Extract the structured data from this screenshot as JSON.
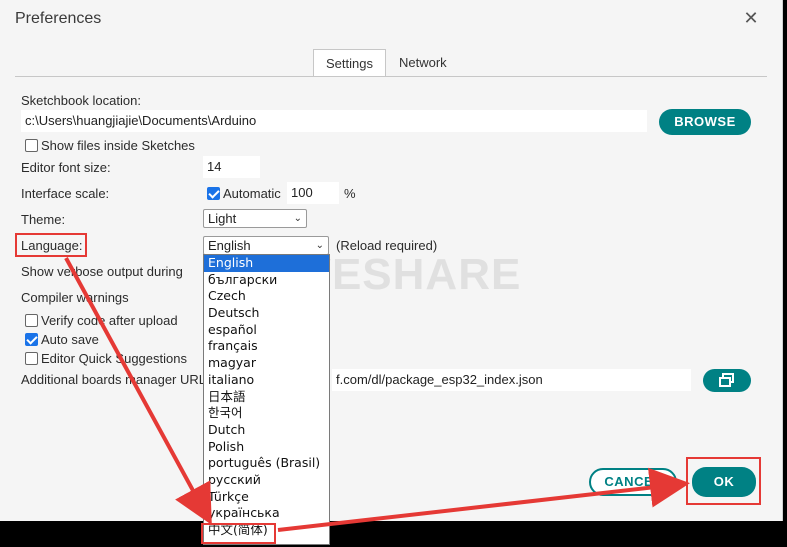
{
  "window": {
    "title": "Preferences"
  },
  "tabs": [
    {
      "label": "Settings",
      "active": true
    },
    {
      "label": "Network",
      "active": false
    }
  ],
  "sketchbook": {
    "label": "Sketchbook location:",
    "path": "c:\\Users\\huangjiajie\\Documents\\Arduino",
    "browse_label": "BROWSE",
    "show_files_label": "Show files inside Sketches",
    "show_files_checked": false
  },
  "editor_font": {
    "label": "Editor font size:",
    "value": "14"
  },
  "interface_scale": {
    "label": "Interface scale:",
    "automatic_label": "Automatic",
    "automatic_checked": true,
    "value": "100",
    "unit": "%"
  },
  "theme": {
    "label": "Theme:",
    "value": "Light"
  },
  "language": {
    "label": "Language:",
    "value": "English",
    "note": "(Reload required)",
    "options": [
      "English",
      "български",
      "Czech",
      "Deutsch",
      "español",
      "français",
      "magyar",
      "italiano",
      "日本語",
      "한국어",
      "Dutch",
      "Polish",
      "português (Brasil)",
      "русский",
      "Türkçe",
      "українська",
      "中文(简体)"
    ],
    "selected_index": 0
  },
  "verbose": {
    "label": "Show verbose output during"
  },
  "compiler_warnings": {
    "label": "Compiler warnings"
  },
  "checkboxes": [
    {
      "label": "Verify code after upload",
      "checked": false
    },
    {
      "label": "Auto save",
      "checked": true
    },
    {
      "label": "Editor Quick Suggestions",
      "checked": false
    }
  ],
  "boards_manager": {
    "label": "Additional boards manager URL",
    "url_value": "f.com/dl/package_esp32_index.json"
  },
  "footer": {
    "cancel_label": "CANCEL",
    "ok_label": "OK"
  },
  "watermark": "WAVESHARE",
  "colors": {
    "accent": "#008184",
    "highlight_red": "#e53935",
    "selection": "#1e6fd9"
  }
}
